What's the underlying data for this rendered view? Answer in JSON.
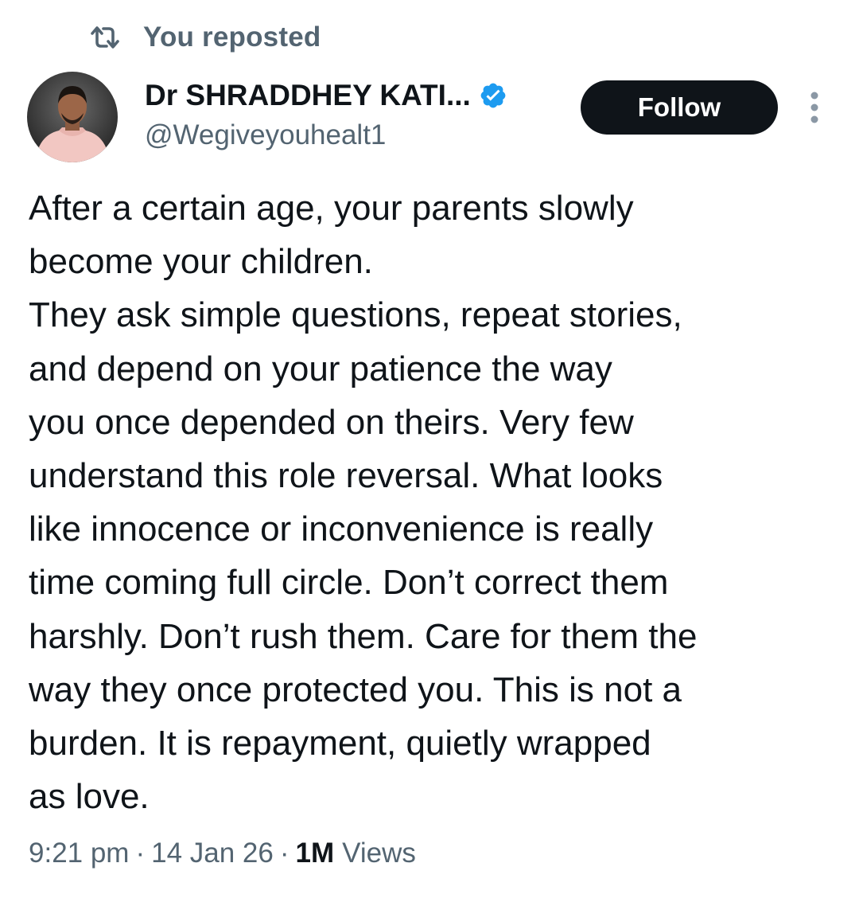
{
  "repost": {
    "label": "You reposted",
    "icon": "repost-icon"
  },
  "author": {
    "display_name": "Dr SHRADDHEY KATI...",
    "handle": "@Wegiveyouhealt1",
    "verified": true,
    "verified_icon": "verified-badge-icon",
    "avatar": "avatar"
  },
  "actions": {
    "follow_label": "Follow",
    "more_icon": "more-vertical-icon"
  },
  "tweet": {
    "lines": [
      "After a certain age, your parents slowly",
      "become your children.",
      "They ask simple questions, repeat stories,",
      "and depend on your patience the way",
      "you once depended on theirs. Very few",
      "understand this role reversal. What looks",
      "like innocence or inconvenience is really",
      "time coming full circle. Don’t correct them",
      "harshly. Don’t rush them. Care for them the",
      "way they once protected you. This is not a",
      "burden. It is repayment, quietly wrapped",
      "as love."
    ]
  },
  "meta": {
    "time": "9:21 pm",
    "separator": "·",
    "date": "14 Jan 26",
    "views_count": "1M",
    "views_label": "Views"
  },
  "colors": {
    "text_primary": "#0f1419",
    "text_secondary": "#536471",
    "verified_blue": "#1d9bf0",
    "follow_bg": "#0f1419"
  }
}
